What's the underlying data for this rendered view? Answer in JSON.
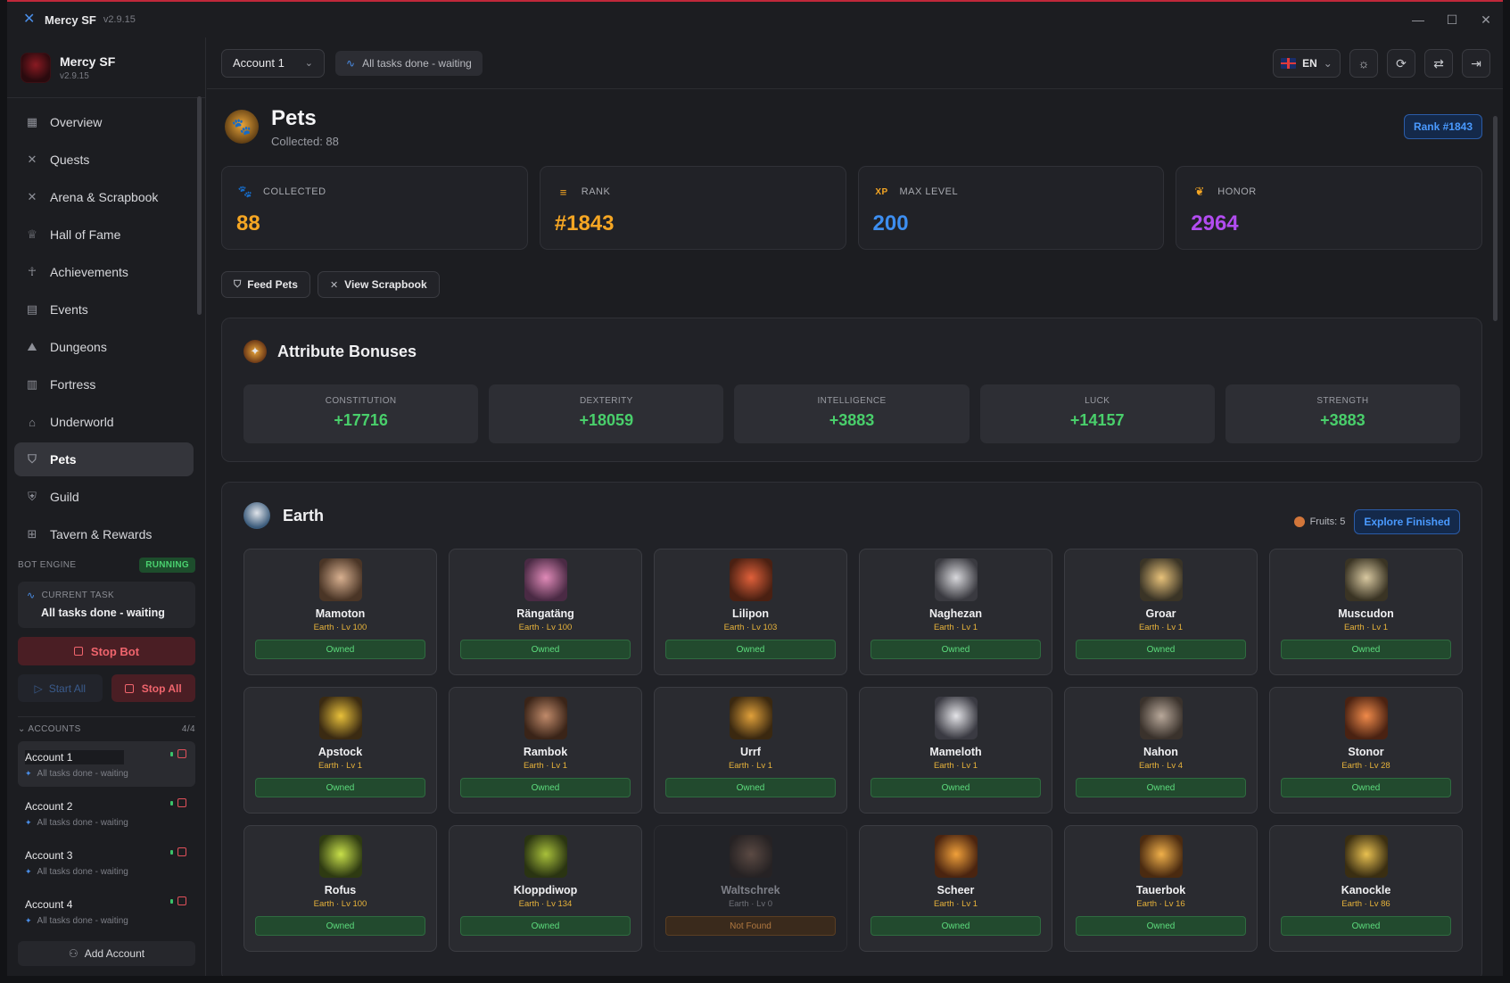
{
  "titlebar": {
    "app": "Mercy SF",
    "version": "v2.9.15"
  },
  "brand": {
    "name": "Mercy SF",
    "version": "v2.9.15"
  },
  "nav": [
    {
      "label": "Overview",
      "icon": "grid-icon"
    },
    {
      "label": "Quests",
      "icon": "swords-icon"
    },
    {
      "label": "Arena & Scrapbook",
      "icon": "swords-icon"
    },
    {
      "label": "Hall of Fame",
      "icon": "trophy-icon"
    },
    {
      "label": "Achievements",
      "icon": "ribbon-icon"
    },
    {
      "label": "Events",
      "icon": "calendar-icon"
    },
    {
      "label": "Dungeons",
      "icon": "mountain-icon"
    },
    {
      "label": "Fortress",
      "icon": "fortress-icon"
    },
    {
      "label": "Underworld",
      "icon": "house-icon"
    },
    {
      "label": "Pets",
      "icon": "paw-icon",
      "active": true
    },
    {
      "label": "Guild",
      "icon": "shield-icon"
    },
    {
      "label": "Tavern & Rewards",
      "icon": "gift-icon"
    }
  ],
  "bot": {
    "label": "BOT ENGINE",
    "status": "RUNNING",
    "current_task_label": "CURRENT TASK",
    "current_task": "All tasks done - waiting",
    "stop_bot": "Stop Bot",
    "start_all": "Start All",
    "stop_all": "Stop All"
  },
  "accounts": {
    "label": "ACCOUNTS",
    "count": "4/4",
    "items": [
      {
        "name": "Account 1",
        "status": "All tasks done - waiting"
      },
      {
        "name": "Account 2",
        "status": "All tasks done - waiting"
      },
      {
        "name": "Account 3",
        "status": "All tasks done - waiting"
      },
      {
        "name": "Account 4",
        "status": "All tasks done - waiting"
      }
    ],
    "add": "Add Account"
  },
  "topbar": {
    "account": "Account 1",
    "task": "All tasks done - waiting",
    "lang": "EN"
  },
  "page": {
    "title": "Pets",
    "subtitle": "Collected: 88",
    "rank_badge": "Rank #1843"
  },
  "stats": [
    {
      "label": "COLLECTED",
      "value": "88",
      "color": "#f5a623",
      "icon": "pet-icon"
    },
    {
      "label": "RANK",
      "value": "#1843",
      "color": "#f5a623",
      "icon": "barrel-icon"
    },
    {
      "label": "MAX LEVEL",
      "value": "200",
      "color": "#3d8ef0",
      "icon": "xp-icon",
      "icon_text": "XP"
    },
    {
      "label": "HONOR",
      "value": "2964",
      "color": "#b24cf0",
      "icon": "laurel-icon"
    }
  ],
  "actions": {
    "feed": "Feed Pets",
    "scrapbook": "View Scrapbook"
  },
  "attributes": {
    "title": "Attribute Bonuses",
    "items": [
      {
        "label": "CONSTITUTION",
        "value": "+17716"
      },
      {
        "label": "DEXTERITY",
        "value": "+18059"
      },
      {
        "label": "INTELLIGENCE",
        "value": "+3883"
      },
      {
        "label": "LUCK",
        "value": "+14157"
      },
      {
        "label": "STRENGTH",
        "value": "+3883"
      }
    ]
  },
  "earth": {
    "title": "Earth",
    "fruits": "Fruits: 5",
    "explore": "Explore Finished",
    "pets": [
      {
        "name": "Mamoton",
        "sub": "Earth · Lv 100",
        "status": "Owned",
        "c1": "#d8b090",
        "c2": "#4a3526"
      },
      {
        "name": "Rängatäng",
        "sub": "Earth · Lv 100",
        "status": "Owned",
        "c1": "#e08ab8",
        "c2": "#4a2a44"
      },
      {
        "name": "Lilipon",
        "sub": "Earth · Lv 103",
        "status": "Owned",
        "c1": "#e0603a",
        "c2": "#4a2012"
      },
      {
        "name": "Naghezan",
        "sub": "Earth · Lv 1",
        "status": "Owned",
        "c1": "#d8d8dc",
        "c2": "#3a3a40"
      },
      {
        "name": "Groar",
        "sub": "Earth · Lv 1",
        "status": "Owned",
        "c1": "#e8c27a",
        "c2": "#3a3426"
      },
      {
        "name": "Muscudon",
        "sub": "Earth · Lv 1",
        "status": "Owned",
        "c1": "#d8c8a0",
        "c2": "#3a3424"
      },
      {
        "name": "Apstock",
        "sub": "Earth · Lv 1",
        "status": "Owned",
        "c1": "#e8c03a",
        "c2": "#3a2a12"
      },
      {
        "name": "Rambok",
        "sub": "Earth · Lv 1",
        "status": "Owned",
        "c1": "#c08a6a",
        "c2": "#3a2418"
      },
      {
        "name": "Urrf",
        "sub": "Earth · Lv 1",
        "status": "Owned",
        "c1": "#e0a03a",
        "c2": "#3a2810"
      },
      {
        "name": "Mameloth",
        "sub": "Earth · Lv 1",
        "status": "Owned",
        "c1": "#e4e4e8",
        "c2": "#3a3a42"
      },
      {
        "name": "Nahon",
        "sub": "Earth · Lv 4",
        "status": "Owned",
        "c1": "#b8a89a",
        "c2": "#3a322c"
      },
      {
        "name": "Stonor",
        "sub": "Earth · Lv 28",
        "status": "Owned",
        "c1": "#f08a4a",
        "c2": "#4a2212"
      },
      {
        "name": "Rofus",
        "sub": "Earth · Lv 100",
        "status": "Owned",
        "c1": "#c8e04a",
        "c2": "#2e3a12"
      },
      {
        "name": "Kloppdiwop",
        "sub": "Earth · Lv 134",
        "status": "Owned",
        "c1": "#a8c03a",
        "c2": "#2a3412"
      },
      {
        "name": "Waltschrek",
        "sub": "Earth · Lv 0",
        "status": "Not Found",
        "c1": "#8a6a5a",
        "c2": "#2a2220",
        "missing": true
      },
      {
        "name": "Scheer",
        "sub": "Earth · Lv 1",
        "status": "Owned",
        "c1": "#f0a03a",
        "c2": "#4a2410"
      },
      {
        "name": "Tauerbok",
        "sub": "Earth · Lv 16",
        "status": "Owned",
        "c1": "#f0b04a",
        "c2": "#4a2a10"
      },
      {
        "name": "Kanockle",
        "sub": "Earth · Lv 86",
        "status": "Owned",
        "c1": "#e8c050",
        "c2": "#3a2e12"
      }
    ]
  }
}
